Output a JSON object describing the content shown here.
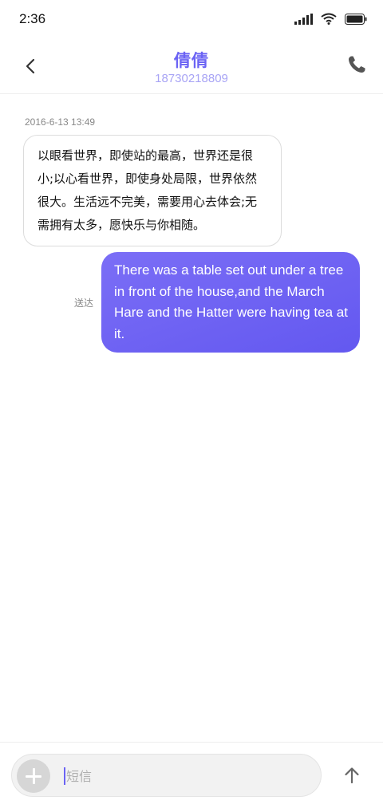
{
  "status_bar": {
    "time": "2:36",
    "icons": [
      "signal-icon",
      "wifi-icon",
      "battery-icon"
    ]
  },
  "header": {
    "contact_name": "倩倩",
    "contact_number": "18730218809",
    "back_icon": "chevron-left-icon",
    "call_icon": "phone-icon"
  },
  "conversation": {
    "timestamp": "2016-6-13 13:49",
    "messages": [
      {
        "direction": "incoming",
        "text": "以眼看世界，即使站的最高，世界还是很小;以心看世界，即使身处局限，世界依然很大。生活远不完美，需要用心去体会;无需拥有太多，愿快乐与你相随。"
      },
      {
        "direction": "outgoing",
        "text": "There was a table set out under a tree in front of the house,and the March Hare and the Hatter were having tea at it.",
        "status": "送达"
      }
    ]
  },
  "composer": {
    "placeholder": "短信",
    "add_icon": "plus-icon",
    "send_icon": "arrow-up-icon"
  },
  "colors": {
    "accent": "#6b63f4",
    "accent_light": "#a8a4f5",
    "bubble_out_start": "#7b6ef6",
    "bubble_out_end": "#6358f0"
  }
}
